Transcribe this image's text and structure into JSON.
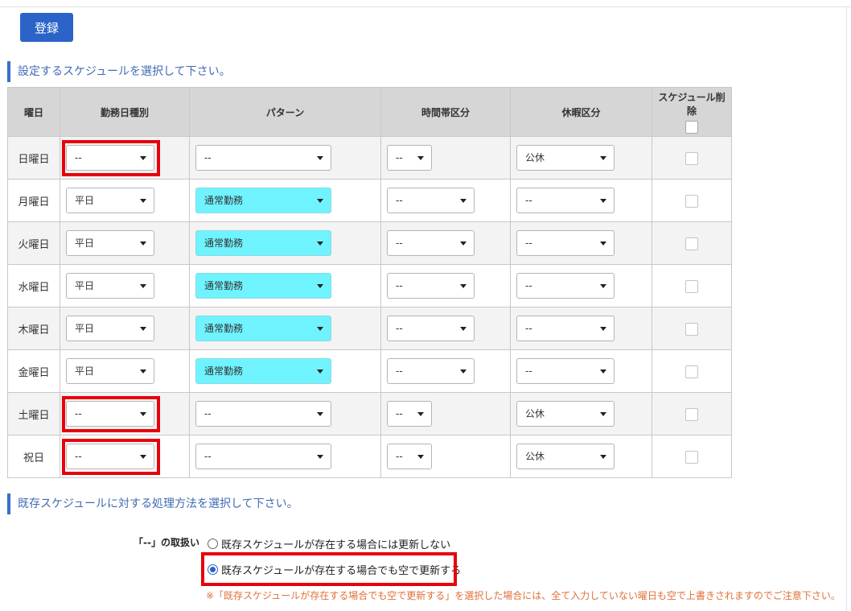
{
  "register_label": "登録",
  "section1_title": "設定するスケジュールを選択して下さい。",
  "section2_title": "既存スケジュールに対する処理方法を選択して下さい。",
  "table": {
    "headers": {
      "day": "曜日",
      "work_type": "勤務日種別",
      "pattern": "パターン",
      "time_zone": "時間帯区分",
      "holiday": "休暇区分",
      "delete": "スケジュール削除"
    },
    "rows": [
      {
        "day": "日曜日",
        "work_type": "--",
        "pattern": "--",
        "time_zone": "--",
        "holiday": "公休"
      },
      {
        "day": "月曜日",
        "work_type": "平日",
        "pattern": "通常勤務",
        "time_zone": "--",
        "holiday": "--"
      },
      {
        "day": "火曜日",
        "work_type": "平日",
        "pattern": "通常勤務",
        "time_zone": "--",
        "holiday": "--"
      },
      {
        "day": "水曜日",
        "work_type": "平日",
        "pattern": "通常勤務",
        "time_zone": "--",
        "holiday": "--"
      },
      {
        "day": "木曜日",
        "work_type": "平日",
        "pattern": "通常勤務",
        "time_zone": "--",
        "holiday": "--"
      },
      {
        "day": "金曜日",
        "work_type": "平日",
        "pattern": "通常勤務",
        "time_zone": "--",
        "holiday": "--"
      },
      {
        "day": "土曜日",
        "work_type": "--",
        "pattern": "--",
        "time_zone": "--",
        "holiday": "公休"
      },
      {
        "day": "祝日",
        "work_type": "--",
        "pattern": "--",
        "time_zone": "--",
        "holiday": "公休"
      }
    ]
  },
  "handling": {
    "label": "「--」の取扱い",
    "option1": "既存スケジュールが存在する場合には更新しない",
    "option2": "既存スケジュールが存在する場合でも空で更新する",
    "selected": "option2",
    "note": "※「既存スケジュールが存在する場合でも空で更新する」を選択した場合には、全て入力していない曜日も空で上書きされますのでご注意下さい。"
  },
  "colors": {
    "primary_button": "#2b63c9",
    "pattern_highlight": "#6ff3ff",
    "annotation_box": "#e8000b",
    "sunday_holiday_text": "#e05555",
    "saturday_text": "#3a6fb5",
    "note_text": "#e0703a"
  }
}
